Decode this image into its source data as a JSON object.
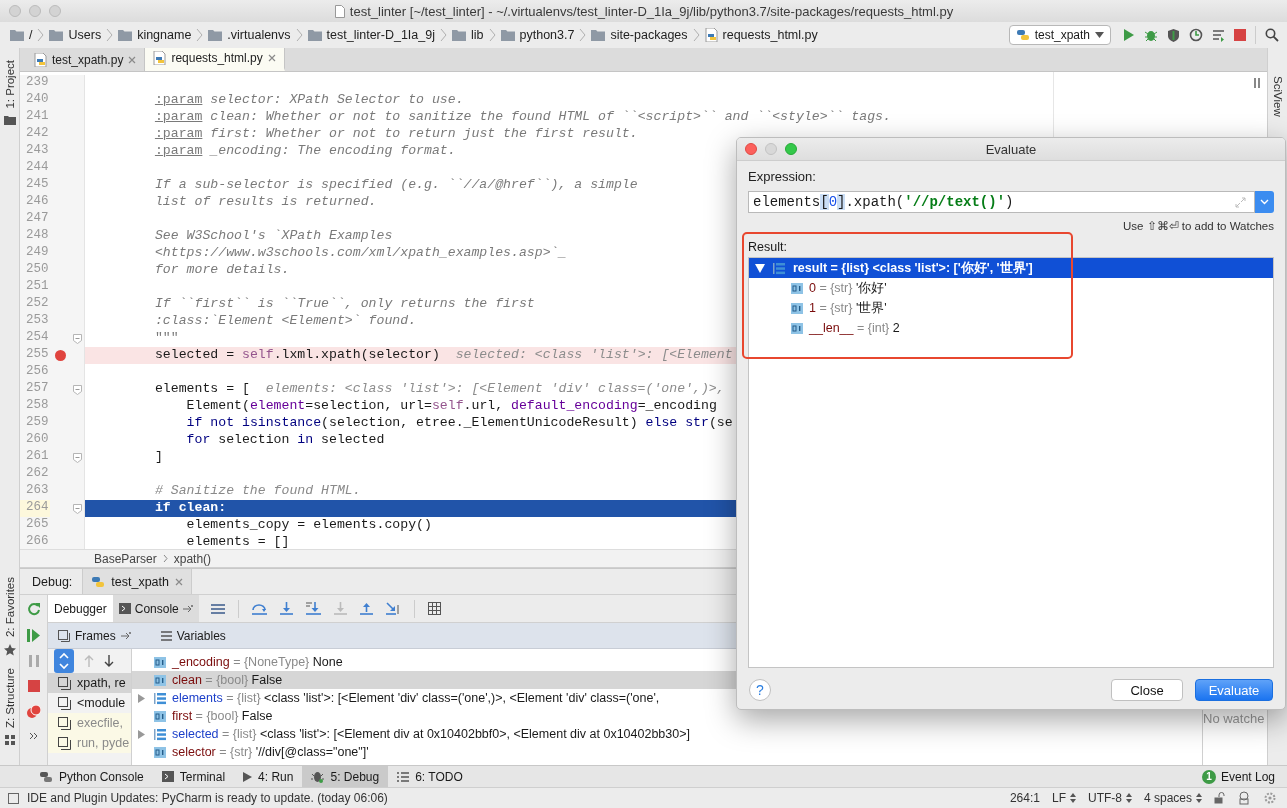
{
  "window": {
    "title": "test_linter [~/test_linter] - ~/.virtualenvs/test_linter-D_1Ia_9j/lib/python3.7/site-packages/requests_html.py"
  },
  "navigation": {
    "path": [
      {
        "label": "/",
        "kind": "folder"
      },
      {
        "label": "Users",
        "kind": "folder"
      },
      {
        "label": "kingname",
        "kind": "folder"
      },
      {
        "label": ".virtualenvs",
        "kind": "folder"
      },
      {
        "label": "test_linter-D_1Ia_9j",
        "kind": "folder"
      },
      {
        "label": "lib",
        "kind": "folder"
      },
      {
        "label": "python3.7",
        "kind": "folder"
      },
      {
        "label": "site-packages",
        "kind": "folder"
      },
      {
        "label": "requests_html.py",
        "kind": "file"
      }
    ],
    "run_config": "test_xpath"
  },
  "left_strip": [
    "1: Project",
    "2: Favorites",
    "Z: Structure"
  ],
  "right_strip": [
    "SciView"
  ],
  "editor_tabs": [
    {
      "label": "test_xpath.py",
      "selected": false
    },
    {
      "label": "requests_html.py",
      "selected": true
    }
  ],
  "editor": {
    "lines": [
      {
        "number": "239",
        "breakpoint": false,
        "current": false,
        "fold": false
      },
      {
        "number": "240",
        "segments": [
          {
            "text": "        :param",
            "kind": "doctag"
          },
          {
            "text": " selector: XPath Selector to use.",
            "kind": "doc"
          }
        ],
        "breakpoint": false,
        "current": false,
        "fold": false
      },
      {
        "number": "241",
        "segments": [
          {
            "text": "        :param",
            "kind": "doctag"
          },
          {
            "text": " clean: Whether or not to sanitize the found HTML of ``<script>`` and ``<style>`` tags.",
            "kind": "doc"
          }
        ],
        "breakpoint": false,
        "current": false,
        "fold": false
      },
      {
        "number": "242",
        "segments": [
          {
            "text": "        :param",
            "kind": "doctag"
          },
          {
            "text": " first: Whether or not to return just the first result.",
            "kind": "doc"
          }
        ],
        "breakpoint": false,
        "current": false,
        "fold": false
      },
      {
        "number": "243",
        "segments": [
          {
            "text": "        :param",
            "kind": "doctag"
          },
          {
            "text": " _encoding: The encoding format.",
            "kind": "doc"
          }
        ],
        "breakpoint": false,
        "current": false,
        "fold": false
      },
      {
        "number": "244",
        "breakpoint": false,
        "current": false,
        "fold": false
      },
      {
        "number": "245",
        "segments": [
          {
            "text": "        If a sub-selector is specified (e.g. ``//a/@href``), a simple",
            "kind": "doc"
          }
        ],
        "breakpoint": false,
        "current": false,
        "fold": false
      },
      {
        "number": "246",
        "segments": [
          {
            "text": "        list of results is returned.",
            "kind": "doc"
          }
        ],
        "breakpoint": false,
        "current": false,
        "fold": false
      },
      {
        "number": "247",
        "breakpoint": false,
        "current": false,
        "fold": false
      },
      {
        "number": "248",
        "segments": [
          {
            "text": "        See W3School's `XPath Examples",
            "kind": "doc"
          }
        ],
        "breakpoint": false,
        "current": false,
        "fold": false
      },
      {
        "number": "249",
        "segments": [
          {
            "text": "        <https://www.w3schools.com/xml/xpath_examples.asp>`_",
            "kind": "doc"
          }
        ],
        "breakpoint": false,
        "current": false,
        "fold": false
      },
      {
        "number": "250",
        "segments": [
          {
            "text": "        for more details.",
            "kind": "doc"
          }
        ],
        "breakpoint": false,
        "current": false,
        "fold": false
      },
      {
        "number": "251",
        "breakpoint": false,
        "current": false,
        "fold": false
      },
      {
        "number": "252",
        "segments": [
          {
            "text": "        If ``first`` is ``True``, only returns the first",
            "kind": "doc"
          }
        ],
        "breakpoint": false,
        "current": false,
        "fold": false
      },
      {
        "number": "253",
        "segments": [
          {
            "text": "        :class:`Element <Element>` found.",
            "kind": "doc"
          }
        ],
        "breakpoint": false,
        "current": false,
        "fold": false
      },
      {
        "number": "254",
        "segments": [
          {
            "text": "        \"\"\"",
            "kind": "docend"
          }
        ],
        "breakpoint": false,
        "current": false,
        "fold": true
      },
      {
        "number": "255",
        "segments": [
          {
            "text": "        selected = ",
            "kind": "plain"
          },
          {
            "text": "self",
            "kind": "self"
          },
          {
            "text": ".lxml.xpath(selector)",
            "kind": "plain"
          }
        ],
        "hint": "selected: <class 'list'>: [<Element",
        "breakpoint": true,
        "current": false,
        "fold": false
      },
      {
        "number": "256",
        "breakpoint": false,
        "current": false,
        "fold": false
      },
      {
        "number": "257",
        "segments": [
          {
            "text": "        elements = [",
            "kind": "plain"
          }
        ],
        "hint": "elements: <class 'list'>: [<Element 'div' class=('one',)>,",
        "breakpoint": false,
        "current": false,
        "fold": true
      },
      {
        "number": "258",
        "segments": [
          {
            "text": "            Element(",
            "kind": "plain"
          },
          {
            "text": "element",
            "kind": "arg"
          },
          {
            "text": "=selection, url=",
            "kind": "plain"
          },
          {
            "text": "self",
            "kind": "self"
          },
          {
            "text": ".url, ",
            "kind": "plain"
          },
          {
            "text": "default_encoding",
            "kind": "arg"
          },
          {
            "text": "=_encoding",
            "kind": "plain"
          }
        ],
        "breakpoint": false,
        "current": false,
        "fold": false
      },
      {
        "number": "259",
        "segments": [
          {
            "text": "            if not ",
            "kind": "kw"
          },
          {
            "text": "isinstance",
            "kind": "builtin"
          },
          {
            "text": "(selection, etree._ElementUnicodeResult) ",
            "kind": "plain"
          },
          {
            "text": "else ",
            "kind": "kw"
          },
          {
            "text": "str",
            "kind": "builtin"
          },
          {
            "text": "(se",
            "kind": "plain"
          }
        ],
        "breakpoint": false,
        "current": false,
        "fold": false
      },
      {
        "number": "260",
        "segments": [
          {
            "text": "            for ",
            "kind": "kw"
          },
          {
            "text": "selection ",
            "kind": "plain"
          },
          {
            "text": "in ",
            "kind": "kw"
          },
          {
            "text": "selected",
            "kind": "plain"
          }
        ],
        "breakpoint": false,
        "current": false,
        "fold": false
      },
      {
        "number": "261",
        "segments": [
          {
            "text": "        ]",
            "kind": "plain"
          }
        ],
        "breakpoint": false,
        "current": false,
        "fold": true
      },
      {
        "number": "262",
        "breakpoint": false,
        "current": false,
        "fold": false
      },
      {
        "number": "263",
        "segments": [
          {
            "text": "        # Sanitize the found HTML.",
            "kind": "comment"
          }
        ],
        "breakpoint": false,
        "current": false,
        "fold": false
      },
      {
        "number": "264",
        "segments": [
          {
            "text": "        if ",
            "kind": "kw"
          },
          {
            "text": "clean:",
            "kind": "plain"
          }
        ],
        "breakpoint": false,
        "current": true,
        "fold": true
      },
      {
        "number": "265",
        "segments": [
          {
            "text": "            elements_copy = elements.copy()",
            "kind": "plain"
          }
        ],
        "breakpoint": false,
        "current": false,
        "fold": false
      },
      {
        "number": "266",
        "segments": [
          {
            "text": "            elements = []",
            "kind": "plain"
          }
        ],
        "breakpoint": false,
        "current": false,
        "fold": false
      }
    ],
    "breadcrumbs": [
      "BaseParser",
      "xpath()"
    ]
  },
  "debug": {
    "title": "Debug:",
    "session": "test_xpath",
    "tabs": [
      {
        "label": "Debugger",
        "selected": true
      },
      {
        "label": "Console",
        "selected": false
      }
    ],
    "frames_header": "Frames",
    "variables_header": "Variables",
    "frames": [
      {
        "label": "xpath, re",
        "selected": true,
        "library": false
      },
      {
        "label": "<module",
        "selected": false,
        "library": false
      },
      {
        "label": "execfile,",
        "selected": false,
        "library": true
      },
      {
        "label": "run, pyde",
        "selected": false,
        "library": true
      }
    ],
    "variables": [
      {
        "name": "_encoding",
        "type": "= {NoneType}",
        "value": "None",
        "kind": "scalar",
        "selected": false
      },
      {
        "name": "clean",
        "type": "= {bool}",
        "value": "False",
        "kind": "scalar",
        "selected": true
      },
      {
        "name": "elements",
        "type": "= {list}",
        "value": "<class 'list'>: [<Element 'div' class=('one',)>, <Element 'div' class=('one',",
        "kind": "list",
        "selected": false
      },
      {
        "name": "first",
        "type": "= {bool}",
        "value": "False",
        "kind": "scalar",
        "selected": false
      },
      {
        "name": "selected",
        "type": "= {list}",
        "value": "<class 'list'>: [<Element div at 0x10402bbf0>, <Element div at 0x10402bb30>]",
        "kind": "list",
        "selected": false
      },
      {
        "name": "selector",
        "type": "= {str}",
        "value": "'//div[@class=\"one\"]'",
        "kind": "scalar",
        "selected": false
      }
    ],
    "watches": "No watche"
  },
  "evaluate": {
    "title": "Evaluate",
    "expression_label": "Expression:",
    "expression": [
      {
        "text": "elements",
        "kind": "plain"
      },
      {
        "text": "[",
        "kind": "bracket"
      },
      {
        "text": "0",
        "kind": "number"
      },
      {
        "text": "]",
        "kind": "bracket"
      },
      {
        "text": ".xpath(",
        "kind": "plain"
      },
      {
        "text": "'//p/text()'",
        "kind": "string"
      },
      {
        "text": ")",
        "kind": "plain"
      }
    ],
    "watch_hint": "Use ⇧⌘⏎ to add to Watches",
    "result_label": "Result:",
    "result": {
      "text": "result = {list} <class 'list'>: ['你好', '世界']",
      "expanded": true,
      "selected": true,
      "children": [
        {
          "name": "0",
          "type": "= {str}",
          "value": "'你好'"
        },
        {
          "name": "1",
          "type": "= {str}",
          "value": "'世界'"
        },
        {
          "name": "__len__",
          "type": "= {int}",
          "value": "2"
        }
      ]
    },
    "buttons": [
      {
        "label": "?",
        "kind": "help"
      },
      {
        "label": "Close",
        "kind": "default"
      },
      {
        "label": "Evaluate",
        "kind": "primary"
      }
    ]
  },
  "tool_windows": [
    {
      "label": "Python Console",
      "kind": "console",
      "selected": false
    },
    {
      "label": "Terminal",
      "kind": "terminal",
      "selected": false
    },
    {
      "label": "4: Run",
      "kind": "run",
      "selected": false
    },
    {
      "label": "5: Debug",
      "kind": "debug",
      "selected": true
    },
    {
      "label": "6: TODO",
      "kind": "todo",
      "selected": false
    }
  ],
  "event_log": {
    "label": "Event Log",
    "count": "1"
  },
  "status": {
    "message": "IDE and Plugin Updates: PyCharm is ready to update. (today 06:06)",
    "position": "264:1",
    "line_separator": "LF",
    "encoding": "UTF-8",
    "indent": "4 spaces"
  }
}
